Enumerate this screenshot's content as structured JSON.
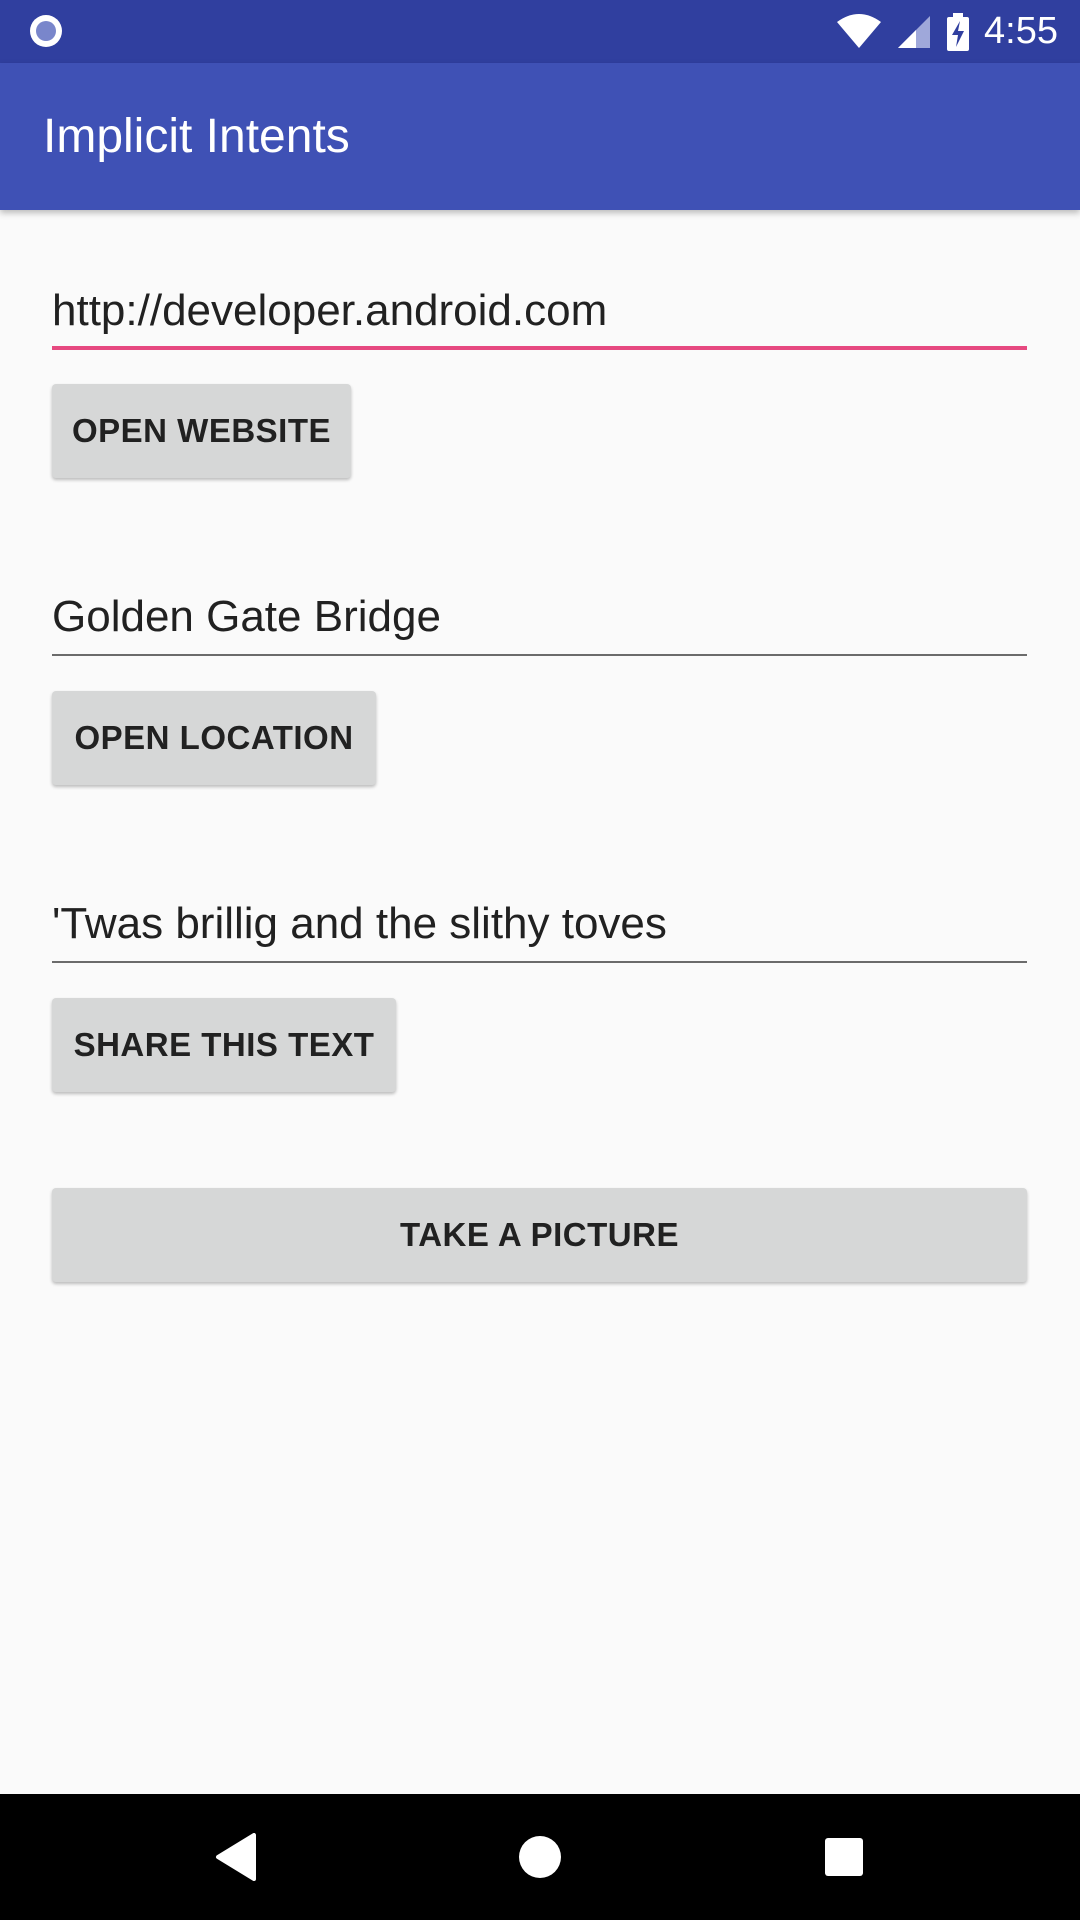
{
  "status_bar": {
    "time": "4:55",
    "icons": [
      "notification-circle-icon",
      "wifi-icon",
      "cellular-signal-icon",
      "battery-charging-icon"
    ],
    "background": "#303f9f"
  },
  "app_bar": {
    "title": "Implicit Intents",
    "background": "#3f51b5"
  },
  "form": {
    "website": {
      "value": "http://developer.android.com",
      "button_label": "OPEN WEBSITE"
    },
    "location": {
      "value": "Golden Gate Bridge",
      "button_label": "OPEN LOCATION"
    },
    "share": {
      "value": "'Twas brillig and the slithy toves",
      "button_label": "SHARE THIS TEXT"
    },
    "camera": {
      "button_label": "TAKE A PICTURE"
    },
    "accent_color": "#e64980"
  },
  "nav_bar": {
    "icons": [
      "back-icon",
      "home-icon",
      "recents-icon"
    ]
  }
}
